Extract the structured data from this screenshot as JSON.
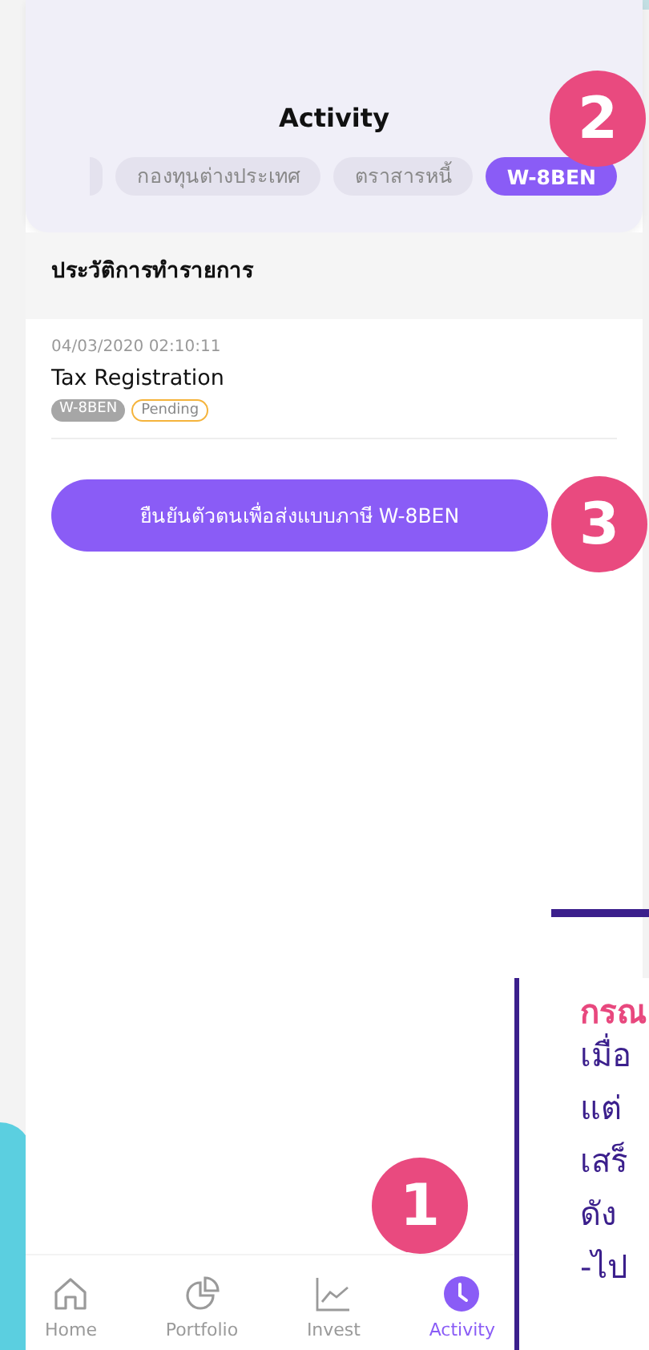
{
  "header": {
    "title": "Activity"
  },
  "tabs": [
    {
      "label": "กองทุนต่างประเทศ",
      "selected": false
    },
    {
      "label": "ตราสารหนี้",
      "selected": false
    },
    {
      "label": "W-8BEN",
      "selected": true
    }
  ],
  "section_title": "ประวัติการทำรายการ",
  "transactions": [
    {
      "datetime": "04/03/2020  02:10:11",
      "title": "Tax Registration",
      "tags": [
        {
          "label": "W-8BEN",
          "kind": "type"
        },
        {
          "label": "Pending",
          "kind": "status"
        }
      ]
    }
  ],
  "action_button": "ยืนยันตัวตนเพื่อส่งแบบภาษี W-8BEN",
  "bottom_nav": [
    {
      "label": "Home",
      "selected": false
    },
    {
      "label": "Portfolio",
      "selected": false
    },
    {
      "label": "Invest",
      "selected": false
    },
    {
      "label": "Activity",
      "selected": true
    }
  ],
  "step_markers": [
    "1",
    "2",
    "3"
  ],
  "note": {
    "title": "กรณ",
    "lines": [
      "เมื่อ",
      "แต่",
      "เสร็",
      "ดัง",
      "-ไป"
    ]
  }
}
